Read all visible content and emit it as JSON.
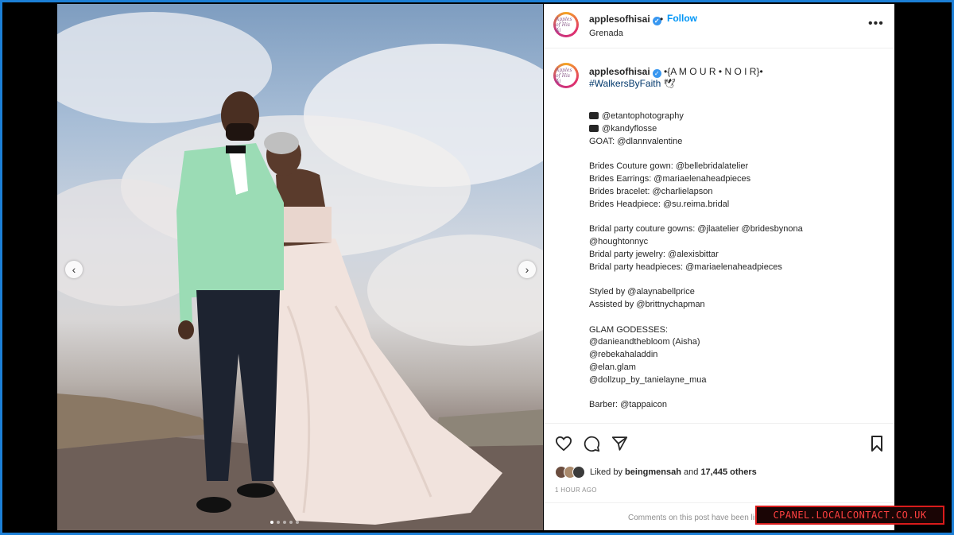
{
  "post": {
    "username": "applesofhisai",
    "location": "Grenada",
    "follow_label": "Follow",
    "dot_separator": "•",
    "more_icon": "more-icon",
    "avatar_text": "Apples of His Ai"
  },
  "caption": {
    "username": "applesofhisai",
    "title": "•{A M O U R • N O I R}•",
    "hashtag": "#WalkersByFaith",
    "hashtag_emoji": "🕊",
    "lines": [
      {
        "text": "@etantophotography",
        "type": "camera"
      },
      {
        "text": "@kandyflosse",
        "type": "camera"
      },
      {
        "text": "GOAT: @dlannvalentine",
        "type": "text"
      },
      {
        "text": "",
        "type": "gap"
      },
      {
        "text": "Brides Couture gown: @bellebridalatelier",
        "type": "text"
      },
      {
        "text": "Brides Earrings: @mariaelenaheadpieces",
        "type": "text"
      },
      {
        "text": "Brides bracelet: @charlielapson",
        "type": "text"
      },
      {
        "text": "Brides Headpiece: @su.reima.bridal",
        "type": "text"
      },
      {
        "text": "",
        "type": "gap"
      },
      {
        "text": "Bridal party couture gowns: @jlaatelier @bridesbynona",
        "type": "text"
      },
      {
        "text": "@houghtonnyc",
        "type": "text"
      },
      {
        "text": "Bridal party jewelry: @alexisbittar",
        "type": "text"
      },
      {
        "text": "Bridal party headpieces: @mariaelenaheadpieces",
        "type": "text"
      },
      {
        "text": "",
        "type": "gap"
      },
      {
        "text": "Styled by @alaynabellprice",
        "type": "text"
      },
      {
        "text": "Assisted by @brittnychapman",
        "type": "text"
      },
      {
        "text": "",
        "type": "gap"
      },
      {
        "text": "GLAM GODESSES:",
        "type": "text"
      },
      {
        "text": "@danieandthebloom (Aisha)",
        "type": "text"
      },
      {
        "text": "@rebekahaladdin",
        "type": "text"
      },
      {
        "text": "@elan.glam",
        "type": "text"
      },
      {
        "text": "@dollzup_by_tanielayne_mua",
        "type": "text"
      },
      {
        "text": "",
        "type": "gap"
      },
      {
        "text": "Barber: @tappaicon",
        "type": "text"
      }
    ]
  },
  "engagement": {
    "liked_by_prefix": "Liked by",
    "liked_by_user": "beingmensah",
    "and": "and",
    "others": "17,445 others",
    "time": "1 HOUR AGO",
    "comments_notice": "Comments on this post have been limited."
  },
  "icons": {
    "like": "heart-icon",
    "comment": "comment-icon",
    "share": "share-icon",
    "save": "bookmark-icon",
    "prev": "chevron-left-icon",
    "next": "chevron-right-icon"
  },
  "watermark": "CPANEL.LOCALCONTACT.CO.UK",
  "colors": {
    "follow": "#0095f6",
    "verified": "#3897f0",
    "frame": "#1c7fd6",
    "watermark": "#d91b1b"
  }
}
